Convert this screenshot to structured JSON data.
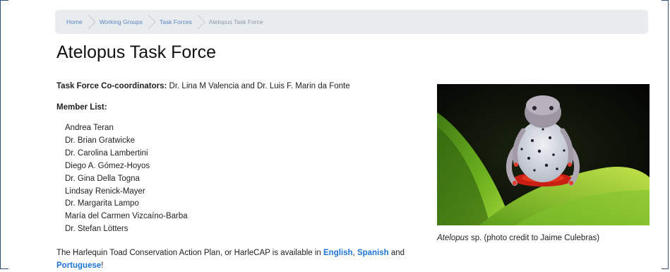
{
  "breadcrumb": {
    "items": [
      {
        "label": "Home",
        "link": true
      },
      {
        "label": "Working Groups",
        "link": true
      },
      {
        "label": "Task Forces",
        "link": true
      },
      {
        "label": "Atelopus Task Force",
        "link": false
      }
    ]
  },
  "page": {
    "title": "Atelopus Task Force",
    "coordinators_label": "Task Force Co-coordinators:",
    "coordinators_value": "Dr. Lina M Valencia and Dr. Luis F. Marin da Fonte",
    "member_heading": "Member List:",
    "members": [
      "Andrea Teran",
      "Dr. Brian Gratwicke",
      "Dr. Carolina Lambertini",
      "Diego A. Gómez-Hoyos",
      "Dr. Gina Della Togna",
      "Lindsay Renick-Mayer",
      "Dr. Margarita Lampo",
      "María del Carmen Vizcaíno-Barba",
      "Dr. Stefan Lötters"
    ],
    "photo": {
      "caption_italic": "Atelopus",
      "caption_rest": " sp. (photo credit to Jaime Culebras)"
    },
    "harlecap": {
      "text_before": "The Harlequin Toad Conservation Action Plan, or HarleCAP is available in ",
      "link_english": "English",
      "sep_comma": ", ",
      "link_spanish": "Spanish",
      "text_and": " and ",
      "link_portuguese": "Portuguese",
      "text_end": "!"
    }
  },
  "colors": {
    "link": "#1e73d8",
    "breadcrumb_link": "#5a84c2",
    "breadcrumb_bg": "#e9ecef",
    "frame_border": "#33507a"
  }
}
